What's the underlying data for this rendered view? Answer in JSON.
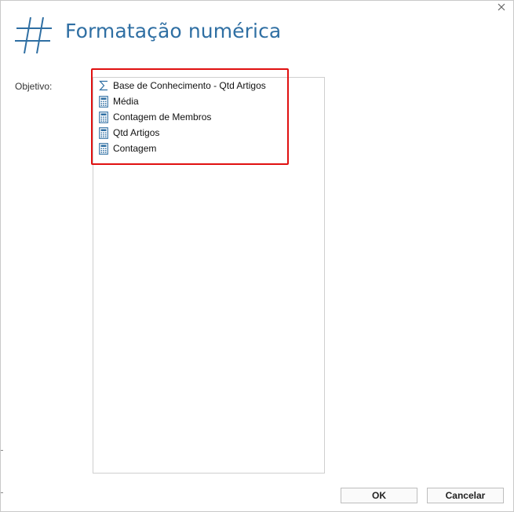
{
  "dialog": {
    "title": "Formatação numérica",
    "header_icon": "hash-icon",
    "close_icon": "close-icon"
  },
  "form": {
    "objective_label": "Objetivo:"
  },
  "list": {
    "items": [
      {
        "label": "Base de Conhecimento - Qtd Artigos",
        "icon": "sum-icon"
      },
      {
        "label": "Média",
        "icon": "calculator-icon"
      },
      {
        "label": "Contagem de Membros",
        "icon": "calculator-icon"
      },
      {
        "label": "Qtd Artigos",
        "icon": "calculator-icon"
      },
      {
        "label": "Contagem",
        "icon": "calculator-icon"
      }
    ]
  },
  "buttons": {
    "ok_label": "OK",
    "cancel_label": "Cancelar"
  },
  "colors": {
    "title": "#2f6fa3",
    "highlight": "#e01010",
    "icon": "#2f6fa3"
  }
}
